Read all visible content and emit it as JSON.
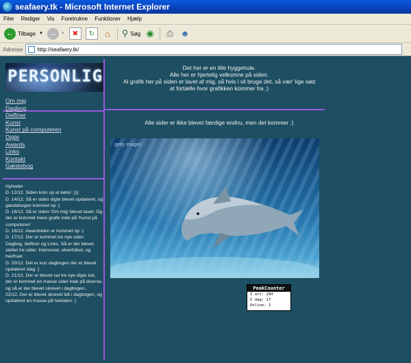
{
  "window": {
    "title": "seafaery.tk - Microsoft Internet Explorer"
  },
  "menu": [
    "Filer",
    "Rediger",
    "Vis",
    "Foretrukne",
    "Funktioner",
    "Hjælp"
  ],
  "toolbar": {
    "back_label": "Tilbage",
    "search_label": "Søg"
  },
  "address": {
    "label": "Adresse",
    "url": "http://seafaery.tk/"
  },
  "sidebar": {
    "logo_text": "PERSONLIG",
    "nav": [
      "Om mig",
      "Dagbog",
      "Delfiner",
      "Kunst",
      "Kunst på computeren",
      "Digte",
      "Awards",
      "Links",
      "Kontakt",
      "Gæstebog"
    ],
    "news_title": "Nyheder",
    "news": [
      "D. 12/12. Siden kom op at køre! :)))",
      "D. 14/12. Så er siden digte blevet opdateret, og gæstebogen kommet op :)",
      "D. 16/12. Så er siden 'Om mig' blevet lavet. Og der er kommet mere grafik inde på 'Kunst på computeren'",
      "D. 16/12. Awardsiden er kommet op :)",
      "D. 17/12. Der er kommet tre nye sider: Dagbog, delfiner og Links. Så er der blevet slettet tre sider: Interesser, elverfolket, og havfruer.",
      "D. 20/12. Det er kun dagbogen der er blevet opdateret idag :)",
      "D. 21/12. Der er blevet sat tre nye digte ind, der er kommet en masse sider inde på diverse, og så er der blevet skrevet i dagbogen..",
      "22/12. Der er blevet skrevet lidt i dagbogen, og opdateret en masse på hetsiden :)"
    ]
  },
  "main": {
    "intro": [
      "Det her er en lille hyggehule.",
      "Alle her er hjertelig velkomne på siden.",
      "Al grafik her på siden er lavet af mig, så hvis i vil bruge det, så vær' lige sød",
      "at fortælle hvor grafikken kommer fra ;)"
    ],
    "notice": "Alle sider er ikke blevet færdige endnu, men det kommer ;)",
    "image_watermark": "getty images"
  },
  "counter": {
    "title": "PeakCounter",
    "total": "I alt: 294",
    "today": "I dag: 17",
    "online": "Online: 1"
  },
  "colors": {
    "page_bg": "#1d4e61",
    "divider": "#9b59e0",
    "titlebar": "#0a5be0"
  }
}
